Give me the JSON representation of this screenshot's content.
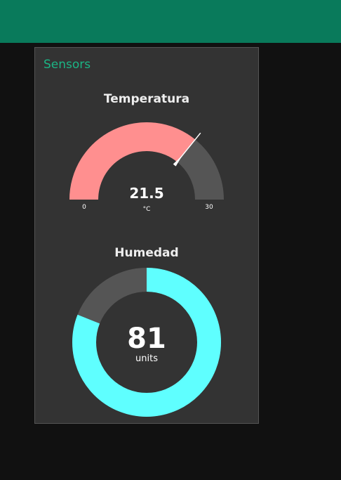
{
  "colors": {
    "header": "#097a5b",
    "card_bg": "#333333",
    "card_title": "#1bb585",
    "gauge_fill": "#ff8f8f",
    "gauge_track": "#555555",
    "donut_fill": "#5fffff",
    "donut_track": "#555555",
    "needle": "#ffffff"
  },
  "group": {
    "title": "Sensors"
  },
  "temperature": {
    "title": "Temperatura",
    "value": 21.5,
    "value_text": "21.5",
    "unit": "°C",
    "min": 0,
    "max": 30,
    "min_label": "0",
    "max_label": "30"
  },
  "humidity": {
    "title": "Humedad",
    "value": 81,
    "value_text": "81",
    "unit": "units",
    "min": 0,
    "max": 100
  }
}
